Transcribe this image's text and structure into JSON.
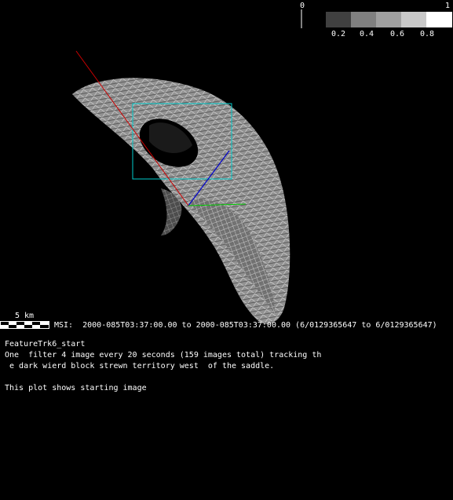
{
  "colorbar": {
    "min_label": "0",
    "max_label": "1",
    "ticks": [
      "0.2",
      "0.4",
      "0.6",
      "0.8"
    ],
    "shades": [
      "#404040",
      "#808080",
      "#a0a0a0",
      "#c8c8c8",
      "#ffffff"
    ]
  },
  "scale_bar": {
    "label": "5 km"
  },
  "msi_line": "MSI:  2000-085T03:37:00.00 to 2000-085T03:37:00.00 (6/0129365647 to 6/0129365647)",
  "caption": {
    "title": "FeatureTrk6_start",
    "line1": "One  filter 4 image every 20 seconds (159 images total) tracking th",
    "line2": " e dark wierd block strewn territory west  of the saddle.",
    "line3": "This plot shows starting image"
  },
  "colors": {
    "background": "#000000",
    "sun_vector": "#cc0000",
    "box": "#00cccc",
    "axis_blue": "#0000cc",
    "axis_green": "#00cc00"
  }
}
